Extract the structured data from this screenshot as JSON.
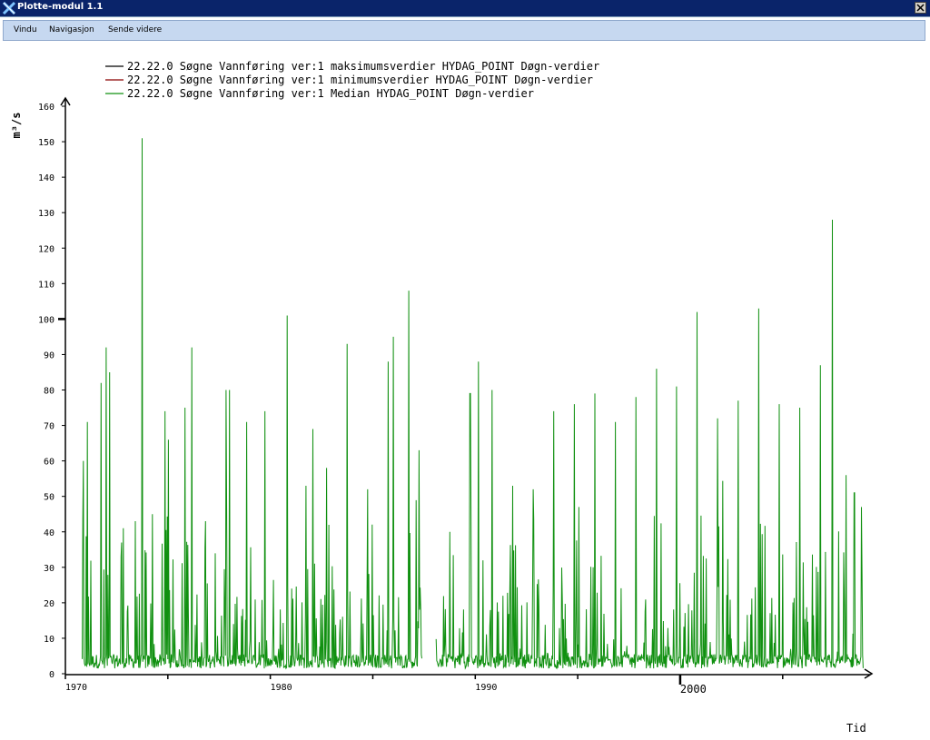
{
  "window": {
    "title": "Plotte-modul 1.1",
    "icons": {
      "app": "x-logo-icon",
      "close": "close-icon"
    }
  },
  "menu": {
    "items": [
      {
        "label": "Vindu"
      },
      {
        "label": "Navigasjon"
      },
      {
        "label": "Sende videre"
      }
    ]
  },
  "colors": {
    "titlebar": "#0a246a",
    "menubar": "#c6d8f0",
    "series_max": "#000000",
    "series_min": "#8b0000",
    "series_median": "#109010"
  },
  "chart_data": {
    "type": "line",
    "ylabel": "m³/s",
    "xlabel": "Tid",
    "ylim": [
      0,
      160
    ],
    "xlim": [
      "1970-01-01",
      "2008-12-31"
    ],
    "y_ticks": [
      "0",
      "10",
      "20",
      "30",
      "40",
      "50",
      "60",
      "70",
      "80",
      "90",
      "100",
      "110",
      "120",
      "130",
      "140",
      "150",
      "160"
    ],
    "x_ticks": [
      "1970",
      "1980",
      "1990",
      "2000"
    ],
    "legend_position": "top-left",
    "legend": [
      {
        "series_id": "22.22.0",
        "station": "Søgne",
        "parameter": "Vannføring",
        "version": "ver:1",
        "kind": "maksimumsverdier",
        "db": "HYDAG_POINT",
        "resolution": "Døgn-verdier",
        "color": "#000000"
      },
      {
        "series_id": "22.22.0",
        "station": "Søgne",
        "parameter": "Vannføring",
        "version": "ver:1",
        "kind": "minimumsverdier",
        "db": "HYDAG_POINT",
        "resolution": "Døgn-verdier",
        "color": "#8b0000"
      },
      {
        "series_id": "22.22.0",
        "station": "Søgne",
        "parameter": "Vannføring",
        "version": "ver:1",
        "kind": "Median",
        "db": "HYDAG_POINT",
        "resolution": "Døgn-verdier",
        "color": "#109010"
      }
    ],
    "series": [
      {
        "name": "22.22.0 Søgne Vannføring ver:1 Median HYDAG_POINT Døgn-verdier",
        "gap": [
          "1987-06-01",
          "1988-02-01"
        ],
        "peaks": [
          {
            "x": "1970-11-15",
            "y": 60
          },
          {
            "x": "1971-02-01",
            "y": 71
          },
          {
            "x": "1971-10-01",
            "y": 82
          },
          {
            "x": "1972-01-01",
            "y": 92
          },
          {
            "x": "1972-03-01",
            "y": 85
          },
          {
            "x": "1972-11-01",
            "y": 41
          },
          {
            "x": "1973-06-01",
            "y": 43
          },
          {
            "x": "1973-10-01",
            "y": 151
          },
          {
            "x": "1974-04-01",
            "y": 45
          },
          {
            "x": "1974-11-15",
            "y": 74
          },
          {
            "x": "1975-01-15",
            "y": 66
          },
          {
            "x": "1975-11-01",
            "y": 75
          },
          {
            "x": "1976-03-01",
            "y": 92
          },
          {
            "x": "1976-11-01",
            "y": 43
          },
          {
            "x": "1977-11-01",
            "y": 80
          },
          {
            "x": "1978-01-01",
            "y": 80
          },
          {
            "x": "1978-11-01",
            "y": 71
          },
          {
            "x": "1979-10-01",
            "y": 74
          },
          {
            "x": "1980-11-01",
            "y": 101
          },
          {
            "x": "1981-10-01",
            "y": 53
          },
          {
            "x": "1982-02-01",
            "y": 69
          },
          {
            "x": "1982-10-01",
            "y": 58
          },
          {
            "x": "1983-10-01",
            "y": 93
          },
          {
            "x": "1984-10-01",
            "y": 52
          },
          {
            "x": "1985-10-01",
            "y": 88
          },
          {
            "x": "1986-01-01",
            "y": 95
          },
          {
            "x": "1986-10-01",
            "y": 108
          },
          {
            "x": "1987-04-01",
            "y": 63
          },
          {
            "x": "1988-10-01",
            "y": 40
          },
          {
            "x": "1989-10-01",
            "y": 79
          },
          {
            "x": "1990-03-01",
            "y": 88
          },
          {
            "x": "1990-11-01",
            "y": 80
          },
          {
            "x": "1991-11-01",
            "y": 53
          },
          {
            "x": "1992-11-01",
            "y": 52
          },
          {
            "x": "1993-11-01",
            "y": 74
          },
          {
            "x": "1994-11-01",
            "y": 76
          },
          {
            "x": "1995-11-01",
            "y": 79
          },
          {
            "x": "1996-11-01",
            "y": 71
          },
          {
            "x": "1997-11-01",
            "y": 78
          },
          {
            "x": "1998-11-01",
            "y": 86
          },
          {
            "x": "1999-11-01",
            "y": 81
          },
          {
            "x": "2000-11-01",
            "y": 102
          },
          {
            "x": "2001-11-01",
            "y": 72
          },
          {
            "x": "2002-11-01",
            "y": 77
          },
          {
            "x": "2003-11-01",
            "y": 103
          },
          {
            "x": "2004-11-01",
            "y": 76
          },
          {
            "x": "2005-11-01",
            "y": 75
          },
          {
            "x": "2006-11-01",
            "y": 87
          },
          {
            "x": "2007-06-01",
            "y": 128
          },
          {
            "x": "2008-02-01",
            "y": 56
          },
          {
            "x": "2008-07-01",
            "y": 51
          },
          {
            "x": "2008-11-01",
            "y": 47
          }
        ]
      }
    ]
  }
}
